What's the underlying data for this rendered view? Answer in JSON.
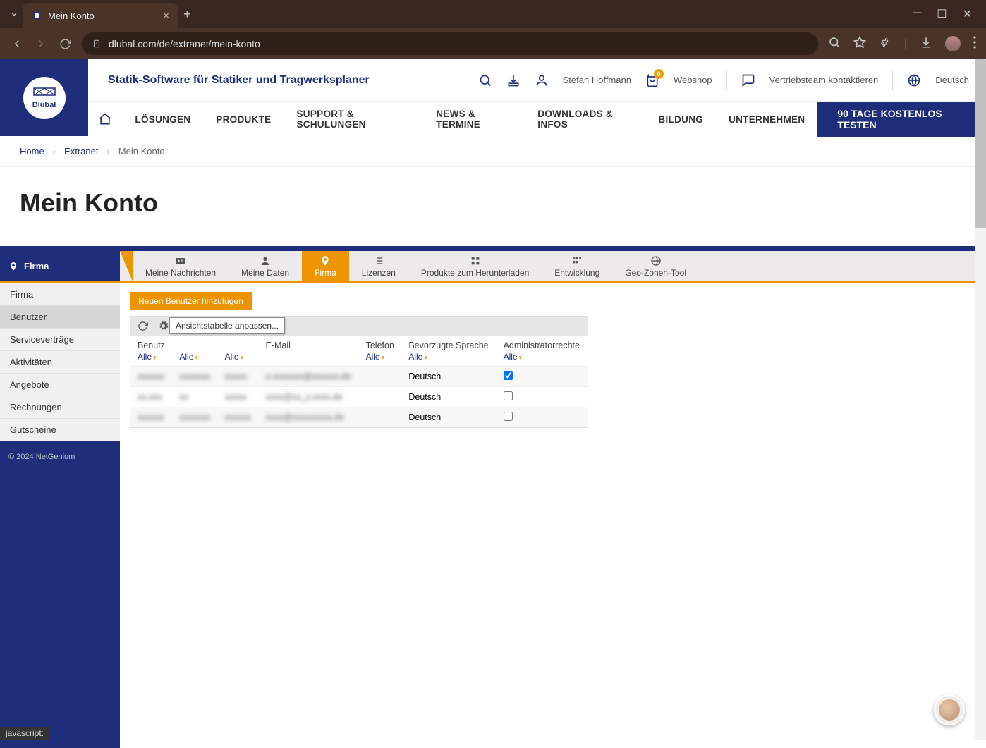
{
  "browser": {
    "tab_title": "Mein Konto",
    "url": "dlubal.com/de/extranet/mein-konto"
  },
  "header": {
    "logo_text": "Dlubal",
    "tagline": "Statik-Software für Statiker und Tragwerksplaner",
    "user_name": "Stefan Hoffmann",
    "webshop": "Webshop",
    "webshop_badge": "0",
    "contact": "Vertriebsteam kontaktieren",
    "language": "Deutsch"
  },
  "nav": {
    "items": [
      "LÖSUNGEN",
      "PRODUKTE",
      "SUPPORT & SCHULUNGEN",
      "NEWS & TERMINE",
      "DOWNLOADS & INFOS",
      "BILDUNG",
      "UNTERNEHMEN"
    ],
    "cta": "90 TAGE KOSTENLOS TESTEN"
  },
  "breadcrumb": [
    "Home",
    "Extranet",
    "Mein Konto"
  ],
  "page_title": "Mein Konto",
  "ext_tabs": {
    "sidebar_title": "Firma",
    "items": [
      "Meine Nachrichten",
      "Meine Daten",
      "Firma",
      "Lizenzen",
      "Produkte zum Herunterladen",
      "Entwicklung",
      "Geo-Zonen-Tool"
    ],
    "active_index": 2
  },
  "sidebar": {
    "items": [
      "Firma",
      "Benutzer",
      "Serviceverträge",
      "Aktivitäten",
      "Angebote",
      "Rechnungen",
      "Gutscheine"
    ],
    "active_index": 1,
    "footer": "© 2024 NetGenium"
  },
  "content": {
    "add_button": "Neuen Benutzer hinzufügen",
    "tooltip": "Ansichtstabelle anpassen...",
    "columns": [
      "Benutz",
      "",
      "",
      "E-Mail",
      "Telefon",
      "Bevorzugte Sprache",
      "Administratorrechte"
    ],
    "filter_label": "Alle",
    "rows": [
      {
        "c0": "xxxxxx",
        "c1": "xxxxxxx",
        "c2": "xxxxx",
        "c3": "x.xxxxxxx@xxxxxx.de",
        "c4": "",
        "lang": "Deutsch",
        "admin": true
      },
      {
        "c0": "xx.xxx",
        "c1": "xx",
        "c2": "xxxxx",
        "c3": "xxxx@xx_x.xxxx.de",
        "c4": "",
        "lang": "Deutsch",
        "admin": false
      },
      {
        "c0": "xxxxxx",
        "c1": "xxxxxxx",
        "c2": "xxxxxx",
        "c3": "xxxx@xxxxxxxxx.de",
        "c4": "",
        "lang": "Deutsch",
        "admin": false
      }
    ]
  },
  "status_bar": "javascript:"
}
